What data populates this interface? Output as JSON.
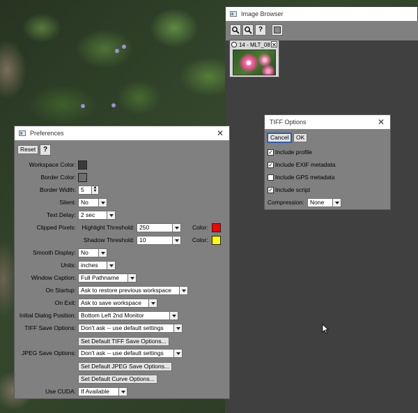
{
  "image_browser": {
    "title": "Image Browser",
    "help_label": "?",
    "thumbnail": {
      "label": "14 - MLT_08",
      "close": "✕"
    }
  },
  "tiff_options": {
    "title": "TIFF Options",
    "close": "✕",
    "cancel_label": "Cancel",
    "ok_label": "OK",
    "options": [
      {
        "label": "Include profile",
        "checked": "✓"
      },
      {
        "label": "Include EXIF metadata",
        "checked": "✓"
      },
      {
        "label": "Include GPS metadata",
        "checked": ""
      },
      {
        "label": "Include script",
        "checked": "✓"
      }
    ],
    "compression_label": "Compression:",
    "compression_value": "None"
  },
  "preferences": {
    "title": "Preferences",
    "close": "✕",
    "reset_label": "Reset",
    "help_label": "?",
    "workspace_color_label": "Workspace Color:",
    "border_color_label": "Border Color:",
    "border_width_label": "Border Width:",
    "border_width_value": "5",
    "silent_label": "Silent:",
    "silent_value": "No",
    "text_delay_label": "Text Delay:",
    "text_delay_value": "2 sec",
    "clipped_pixels_label": "Clipped Pixels:",
    "highlight_threshold_label": "Highlight Threshold:",
    "highlight_threshold_value": "250",
    "shadow_threshold_label": "Shadow Threshold:",
    "shadow_threshold_value": "10",
    "color_label": "Color:",
    "smooth_display_label": "Smooth Display:",
    "smooth_display_value": "No",
    "units_label": "Units:",
    "units_value": "inches",
    "window_caption_label": "Window Caption:",
    "window_caption_value": "Full Pathname",
    "on_startup_label": "On Startup:",
    "on_startup_value": "Ask to restore previous workspace",
    "on_exit_label": "On Exit:",
    "on_exit_value": "Ask to save workspace",
    "initial_dialog_position_label": "Initial Dialog Position:",
    "initial_dialog_position_value": "Bottom Left 2nd Monitor",
    "tiff_save_options_label": "TIFF Save Options:",
    "tiff_save_options_value": "Don't ask -- use default settings",
    "set_default_tiff_label": "Set Default TIFF Save Options...",
    "jpeg_save_options_label": "JPEG Save Options:",
    "jpeg_save_options_value": "Don't ask -- use default settings",
    "set_default_jpeg_label": "Set Default JPEG Save Options...",
    "set_default_curve_label": "Set Default Curve Options...",
    "use_cuda_label": "Use CUDA:",
    "use_cuda_value": "If Available"
  },
  "colors": {
    "workspace_color": "#3a3a3a",
    "border_color": "#6e6e6e",
    "highlight_color": "#ff0000",
    "shadow_color": "#ffff00"
  },
  "icons": [
    "zoom-in-icon",
    "zoom-out-icon",
    "help-icon",
    "color-swatch-icon",
    "window-icon",
    "close-icon",
    "mouse-cursor-icon"
  ]
}
